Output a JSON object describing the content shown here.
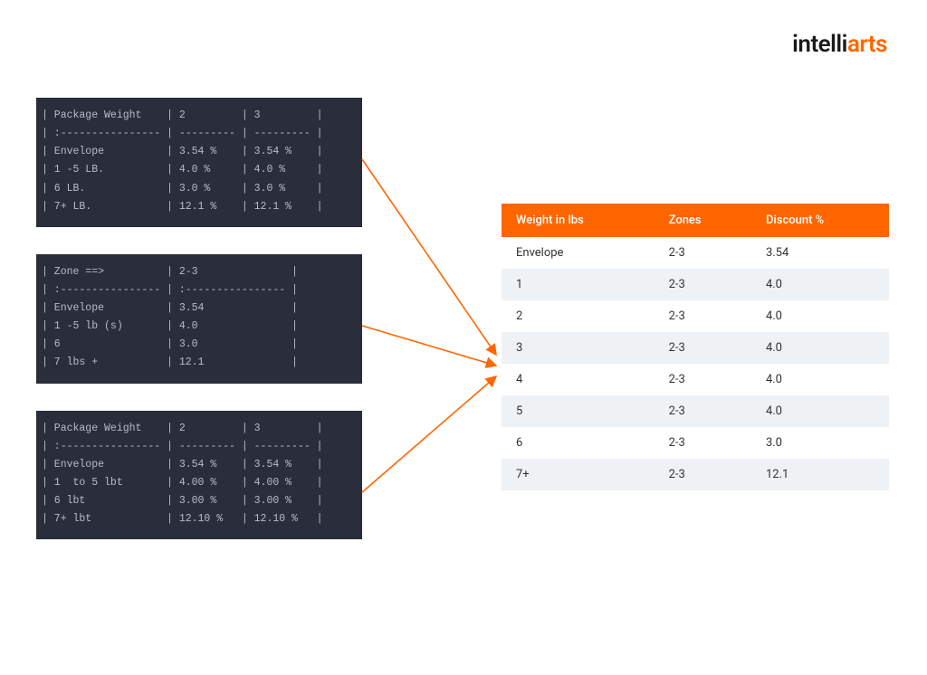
{
  "logo": {
    "part1": "intelli",
    "part2": "arts"
  },
  "colors": {
    "accent": "#ff6600",
    "code_bg": "#2a2d3a",
    "code_fg": "#b8bcc8"
  },
  "code_boxes": [
    {
      "lines": [
        "| Package Weight    | 2         | 3         |",
        "| :---------------- | --------- | --------- |",
        "| Envelope          | 3.54 %    | 3.54 %    |",
        "| 1 -5 LB.          | 4.0 %     | 4.0 %     |",
        "| 6 LB.             | 3.0 %     | 3.0 %     |",
        "| 7+ LB.            | 12.1 %    | 12.1 %    |"
      ]
    },
    {
      "lines": [
        "| Zone ==>          | 2-3               |",
        "| :---------------- | :---------------- |",
        "| Envelope          | 3.54              |",
        "| 1 -5 lb (s)       | 4.0               |",
        "| 6                 | 3.0               |",
        "| 7 lbs +           | 12.1              |"
      ]
    },
    {
      "lines": [
        "| Package Weight    | 2         | 3         |",
        "| :---------------- | --------- | --------- |",
        "| Envelope          | 3.54 %    | 3.54 %    |",
        "| 1  to 5 lbt       | 4.00 %    | 4.00 %    |",
        "| 6 lbt             | 3.00 %    | 3.00 %    |",
        "| 7+ lbt            | 12.10 %   | 12.10 %   |"
      ]
    }
  ],
  "output_table": {
    "headers": [
      "Weight in lbs",
      "Zones",
      "Discount %"
    ],
    "rows": [
      [
        "Envelope",
        "2-3",
        "3.54"
      ],
      [
        "1",
        "2-3",
        "4.0"
      ],
      [
        "2",
        "2-3",
        "4.0"
      ],
      [
        "3",
        "2-3",
        "4.0"
      ],
      [
        "4",
        "2-3",
        "4.0"
      ],
      [
        "5",
        "2-3",
        "4.0"
      ],
      [
        "6",
        "2-3",
        "3.0"
      ],
      [
        "7+",
        "2-3",
        "12.1"
      ]
    ]
  }
}
